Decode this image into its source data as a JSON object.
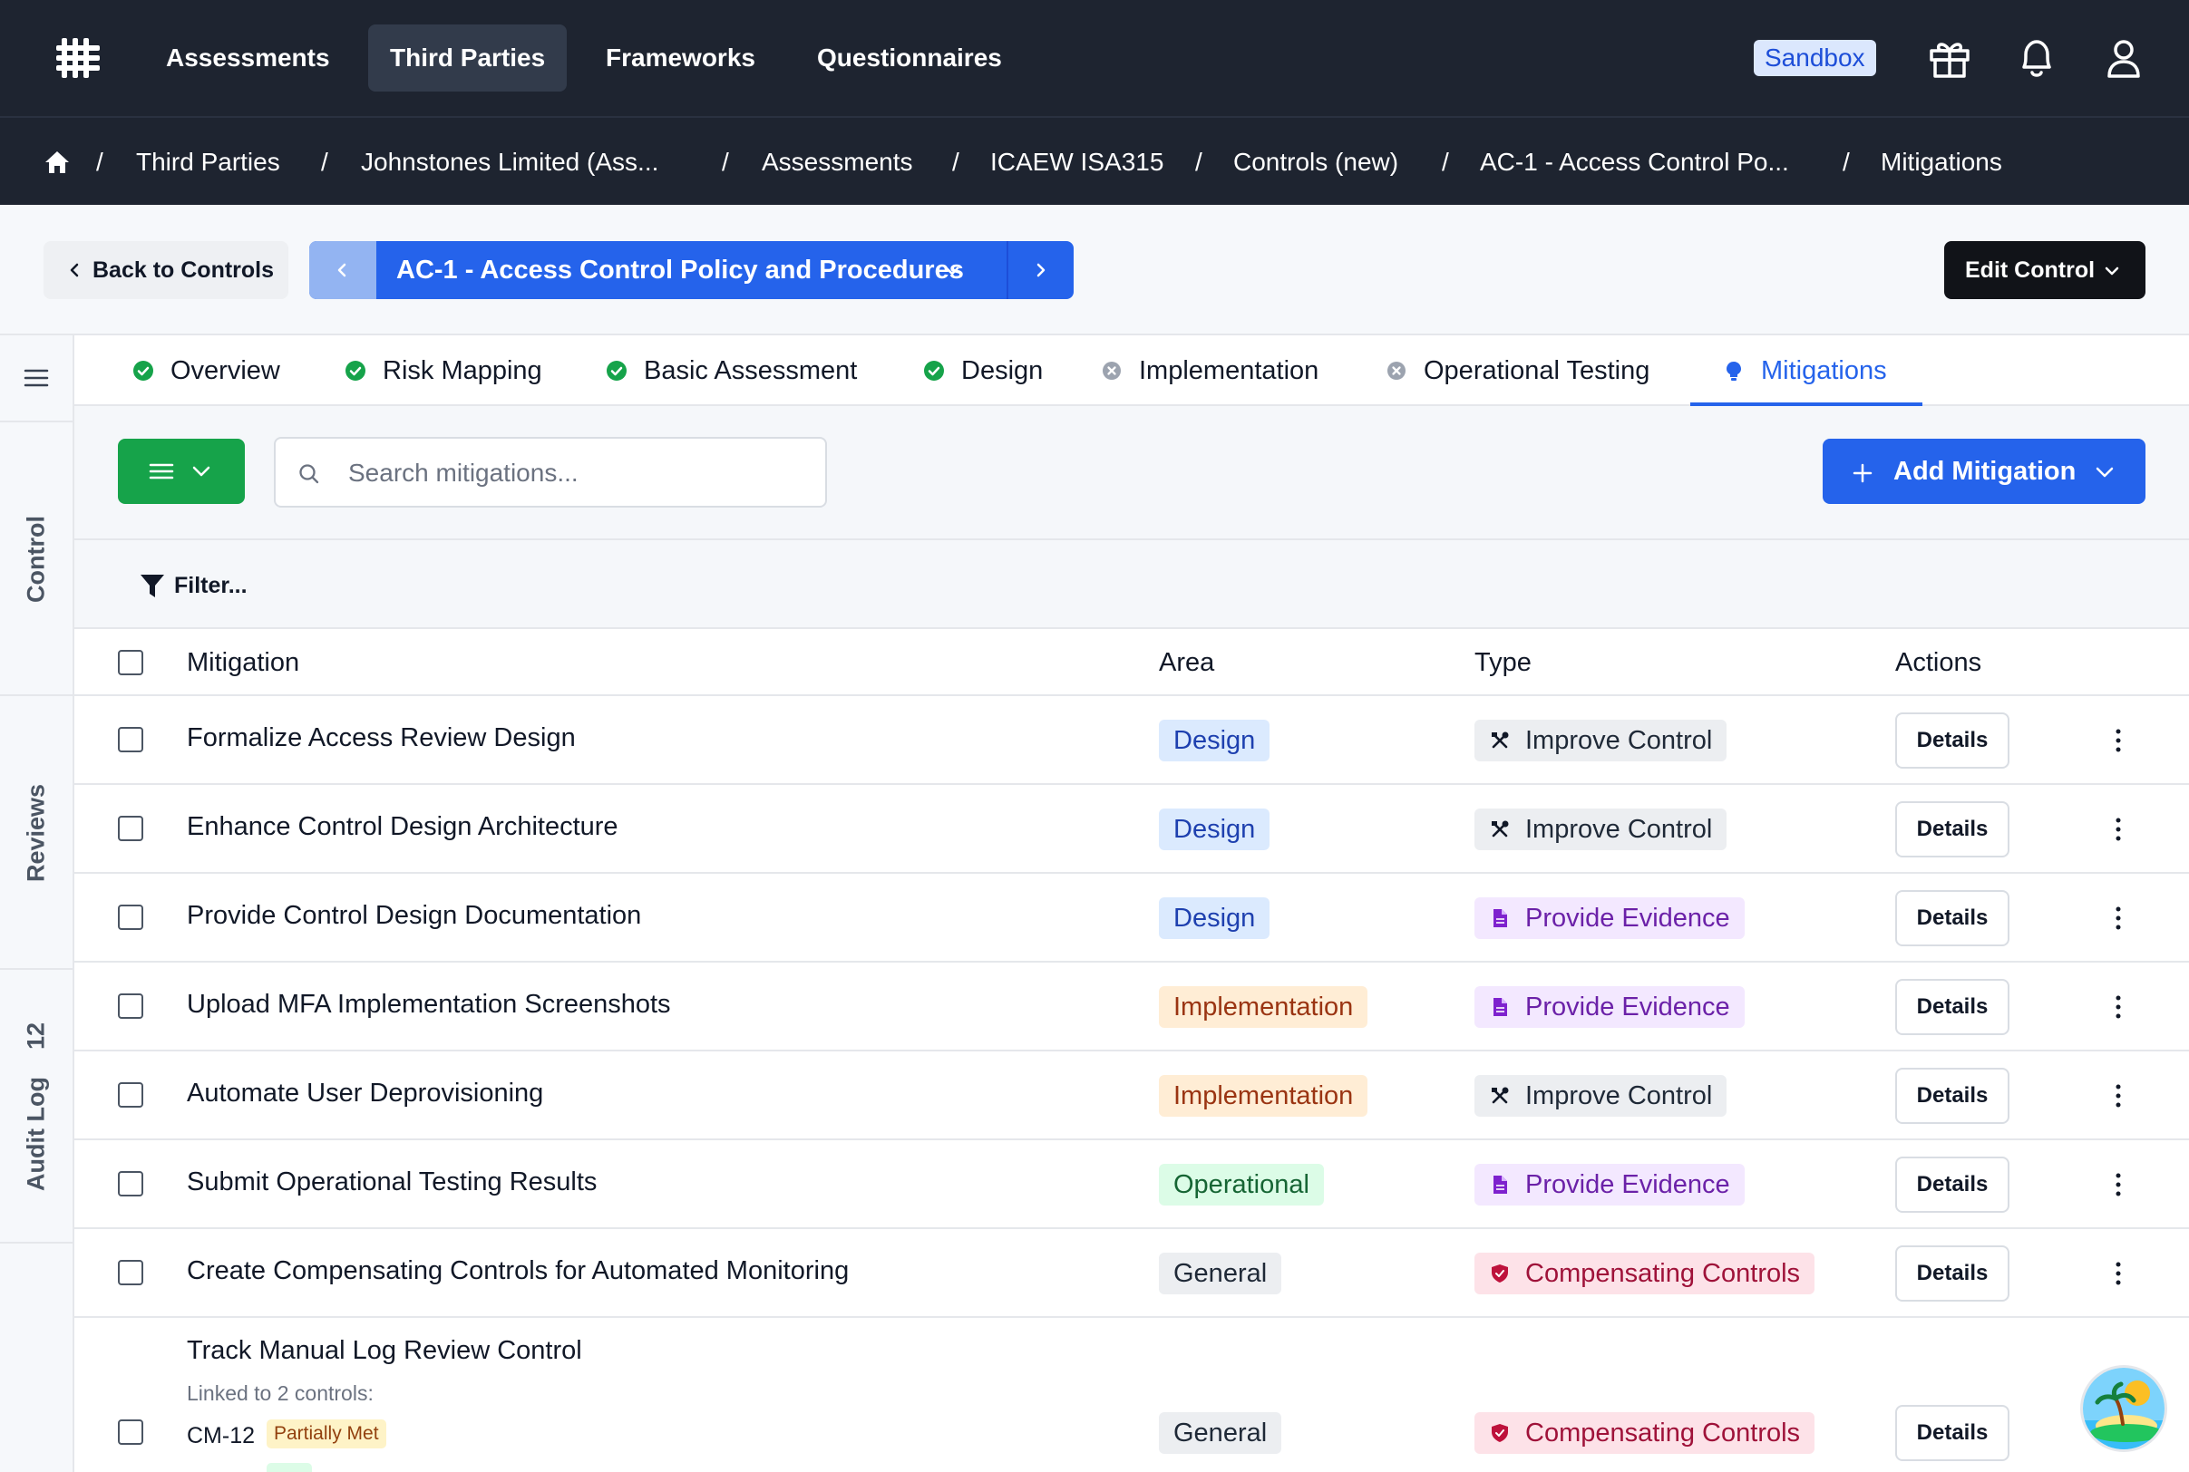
{
  "nav": {
    "items": [
      "Assessments",
      "Third Parties",
      "Frameworks",
      "Questionnaires"
    ],
    "active": "Third Parties",
    "sandbox": "Sandbox"
  },
  "breadcrumbs": [
    "Third Parties",
    "Johnstones Limited (Ass...",
    "Assessments",
    "ICAEW ISA315",
    "Controls (new)",
    "AC-1 - Access Control Po...",
    "Mitigations"
  ],
  "header": {
    "back_label": "Back to Controls",
    "control_title": "AC-1 - Access Control Policy and Procedures",
    "edit_label": "Edit Control"
  },
  "rail": {
    "control": "Control",
    "reviews": "Reviews",
    "audit_log": "Audit Log",
    "audit_count": "12"
  },
  "tabs": [
    {
      "label": "Overview",
      "status": "complete"
    },
    {
      "label": "Risk Mapping",
      "status": "complete"
    },
    {
      "label": "Basic Assessment",
      "status": "complete"
    },
    {
      "label": "Design",
      "status": "complete"
    },
    {
      "label": "Implementation",
      "status": "incomplete"
    },
    {
      "label": "Operational Testing",
      "status": "incomplete"
    },
    {
      "label": "Mitigations",
      "status": "active"
    }
  ],
  "toolbar": {
    "search_placeholder": "Search mitigations...",
    "add_label": "Add Mitigation",
    "filter_label": "Filter..."
  },
  "table": {
    "columns": [
      "Mitigation",
      "Area",
      "Type",
      "Actions"
    ],
    "details_label": "Details",
    "rows": [
      {
        "title": "Formalize Access Review Design",
        "area": "Design",
        "area_kind": "design",
        "type": "Improve Control",
        "type_kind": "improve"
      },
      {
        "title": "Enhance Control Design Architecture",
        "area": "Design",
        "area_kind": "design",
        "type": "Improve Control",
        "type_kind": "improve"
      },
      {
        "title": "Provide Control Design Documentation",
        "area": "Design",
        "area_kind": "design",
        "type": "Provide Evidence",
        "type_kind": "evidence"
      },
      {
        "title": "Upload MFA Implementation Screenshots",
        "area": "Implementation",
        "area_kind": "implementation",
        "type": "Provide Evidence",
        "type_kind": "evidence"
      },
      {
        "title": "Automate User Deprovisioning",
        "area": "Implementation",
        "area_kind": "implementation",
        "type": "Improve Control",
        "type_kind": "improve"
      },
      {
        "title": "Submit Operational Testing Results",
        "area": "Operational",
        "area_kind": "operational",
        "type": "Provide Evidence",
        "type_kind": "evidence"
      },
      {
        "title": "Create Compensating Controls for Automated Monitoring",
        "area": "General",
        "area_kind": "general",
        "type": "Compensating Controls",
        "type_kind": "comp"
      }
    ],
    "last_row": {
      "title": "Track Manual Log Review Control",
      "linked_text": "Linked to 2 controls:",
      "linked": [
        {
          "id": "CM-12",
          "status": "Partially Met"
        }
      ],
      "area": "General",
      "type": "Compensating Controls"
    }
  },
  "colors": {
    "nav_bg": "#1e2430",
    "accent": "#2563eb",
    "success": "#16a34a"
  }
}
